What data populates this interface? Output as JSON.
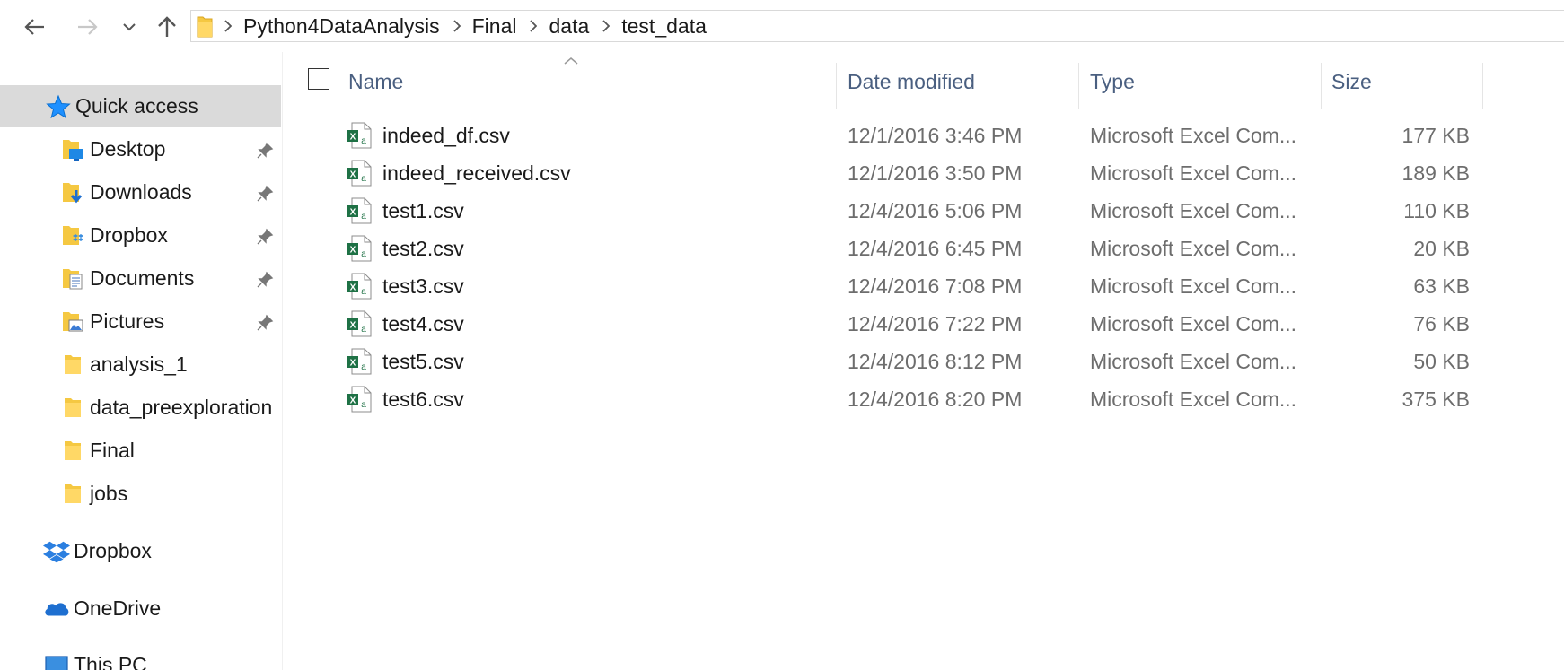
{
  "nav": {
    "back_icon": "arrow-left-icon",
    "forward_icon": "arrow-right-icon",
    "recent_icon": "chevron-down-icon",
    "up_icon": "arrow-up-icon"
  },
  "breadcrumbs": [
    "Python4DataAnalysis",
    "Final",
    "data",
    "test_data"
  ],
  "sidebar": {
    "quick_access": "Quick access",
    "pinned": [
      {
        "label": "Desktop",
        "icon": "desktop-folder-icon"
      },
      {
        "label": "Downloads",
        "icon": "downloads-folder-icon"
      },
      {
        "label": "Dropbox",
        "icon": "dropbox-folder-icon"
      },
      {
        "label": "Documents",
        "icon": "documents-folder-icon"
      },
      {
        "label": "Pictures",
        "icon": "pictures-folder-icon"
      }
    ],
    "folders": [
      "analysis_1",
      "data_preexploration",
      "Final",
      "jobs"
    ],
    "dropbox": "Dropbox",
    "onedrive": "OneDrive",
    "thispc": "This PC"
  },
  "columns": {
    "name": "Name",
    "date": "Date modified",
    "type": "Type",
    "size": "Size"
  },
  "files": [
    {
      "name": "indeed_df.csv",
      "date": "12/1/2016 3:46 PM",
      "type": "Microsoft Excel Com...",
      "size": "177 KB"
    },
    {
      "name": "indeed_received.csv",
      "date": "12/1/2016 3:50 PM",
      "type": "Microsoft Excel Com...",
      "size": "189 KB"
    },
    {
      "name": "test1.csv",
      "date": "12/4/2016 5:06 PM",
      "type": "Microsoft Excel Com...",
      "size": "110 KB"
    },
    {
      "name": "test2.csv",
      "date": "12/4/2016 6:45 PM",
      "type": "Microsoft Excel Com...",
      "size": "20 KB"
    },
    {
      "name": "test3.csv",
      "date": "12/4/2016 7:08 PM",
      "type": "Microsoft Excel Com...",
      "size": "63 KB"
    },
    {
      "name": "test4.csv",
      "date": "12/4/2016 7:22 PM",
      "type": "Microsoft Excel Com...",
      "size": "76 KB"
    },
    {
      "name": "test5.csv",
      "date": "12/4/2016 8:12 PM",
      "type": "Microsoft Excel Com...",
      "size": "50 KB"
    },
    {
      "name": "test6.csv",
      "date": "12/4/2016 8:20 PM",
      "type": "Microsoft Excel Com...",
      "size": "375 KB"
    }
  ],
  "colors": {
    "folder": "#f5c842",
    "excel": "#1e7145",
    "header_text": "#4a5f80",
    "selected_bg": "#dadada",
    "quick_access_star": "#1e90ff"
  }
}
